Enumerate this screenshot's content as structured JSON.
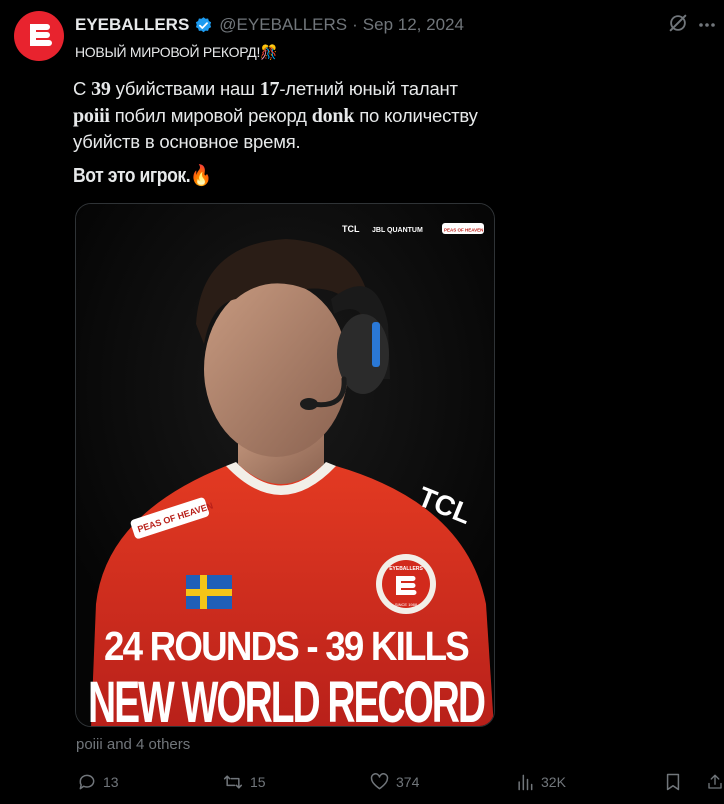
{
  "author": {
    "name": "EYEBALLERS",
    "handle": "@EYEBALLERS",
    "separator": "·",
    "date": "Sep 12, 2024",
    "verified": true
  },
  "post": {
    "subtitle": "НОВЫЙ МИРОВОЙ РЕКОРД!🎊",
    "text_lines": [
      [
        "С ",
        "39",
        " убийствами наш ",
        "17",
        "-летний юный талант"
      ],
      [
        "poiii",
        " побил мировой рекорд ",
        "donk",
        " по количеству"
      ],
      [
        "убийств в основное время."
      ]
    ],
    "headline": "Вот это игрок.🔥"
  },
  "media": {
    "sponsors": [
      "TCL",
      "JBL QUANTUM",
      "PEAS OF HEAVEN"
    ],
    "jersey_text": "TCL",
    "patch_text": "PEAS OF HEAVEN",
    "crest_text": "EYEBALLERS",
    "crest_since": "SINCE 1988",
    "line1": "24 ROUNDS - 39 KILLS",
    "line2": "NEW WORLD RECORD"
  },
  "tagged": "poiii and 4 others",
  "actions": {
    "replies": "13",
    "reposts": "15",
    "likes": "374",
    "views": "32K"
  },
  "colors": {
    "background": "#000000",
    "brand_red": "#e8232e",
    "verified_blue": "#1d9bf0",
    "muted": "#71767b",
    "text": "#e7e9ea"
  }
}
